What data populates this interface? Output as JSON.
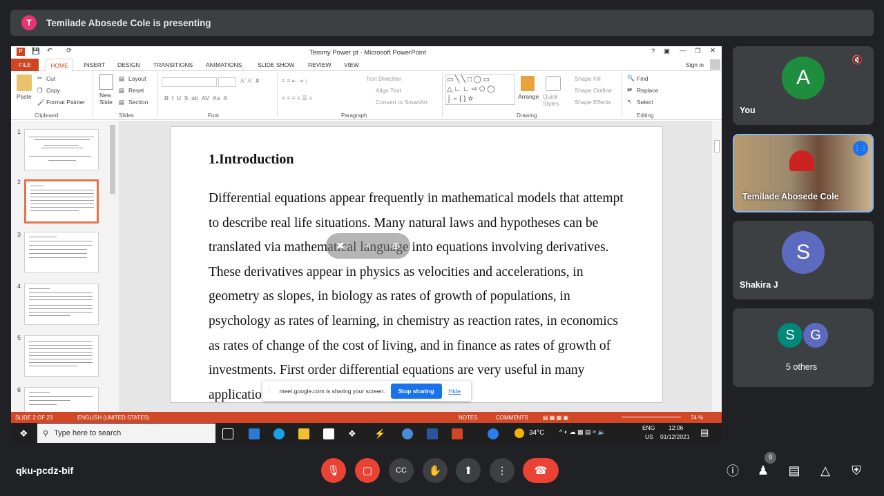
{
  "banner": {
    "initial": "T",
    "text": "Temilade Abosede Cole is presenting"
  },
  "ppt": {
    "window_title": "Temmy Power pt - Microsoft PowerPoint",
    "tabs": [
      "FILE",
      "HOME",
      "INSERT",
      "DESIGN",
      "TRANSITIONS",
      "ANIMATIONS",
      "SLIDE SHOW",
      "REVIEW",
      "VIEW"
    ],
    "sign_in": "Sign in",
    "clipboard": {
      "paste": "Paste",
      "cut": "Cut",
      "copy": "Copy",
      "format_painter": "Format Painter",
      "group": "Clipboard"
    },
    "slides": {
      "new_slide": "New Slide",
      "layout": "Layout",
      "reset": "Reset",
      "section": "Section",
      "group": "Slides"
    },
    "font_group": "Font",
    "paragraph": {
      "text_direction": "Text Direction",
      "align_text": "Align Text",
      "convert": "Convert to SmartArt",
      "group": "Paragraph"
    },
    "drawing": {
      "arrange": "Arrange",
      "quick_styles": "Quick Styles",
      "shape_fill": "Shape Fill",
      "shape_outline": "Shape Outline",
      "shape_effects": "Shape Effects",
      "group": "Drawing"
    },
    "editing": {
      "find": "Find",
      "replace": "Replace",
      "select": "Select",
      "group": "Editing"
    },
    "slide_numbers": [
      "1",
      "2",
      "3",
      "4",
      "5",
      "6"
    ],
    "slide": {
      "heading": "1.Introduction",
      "body": "Differential equations appear frequently in mathematical models that attempt to describe real life situations. Many natural laws and hypotheses can be translated via mathematical language into equations involving derivatives. These derivatives appear in physics as velocities and accelerations, in geometry as slopes, in biology as rates of growth of populations, in psychology as rates of learning, in chemistry as reaction rates, in economics as rates of change of the cost of living, and in finance as rates of growth of investments. First order differential equations are very useful in many applications"
    },
    "share_bar": {
      "text": "meet.google.com is sharing your screen.",
      "stop": "Stop sharing",
      "hide": "Hide"
    },
    "status": {
      "slide": "SLIDE 2 OF 23",
      "lang": "ENGLISH (UNITED STATES)",
      "notes": "NOTES",
      "comments": "COMMENTS",
      "zoom": "74 %"
    },
    "taskbar": {
      "search": "Type here to search",
      "weather": "34°C",
      "lang1": "ENG",
      "lang2": "US",
      "time": "12:06",
      "date": "01/12/2021"
    }
  },
  "participants": [
    {
      "name": "You",
      "initial": "A",
      "color": "#1e8e3e"
    },
    {
      "name": "Temilade Abosede Cole"
    },
    {
      "name": "Shakira J",
      "initial": "S",
      "color": "#5c6bc0"
    },
    {
      "name": "5 others",
      "initials": [
        "S",
        "G"
      ],
      "colors": [
        "#00897b",
        "#5c6bc0"
      ]
    }
  ],
  "meeting": {
    "code": "qku-pcdz-bif",
    "people_count": "9"
  }
}
